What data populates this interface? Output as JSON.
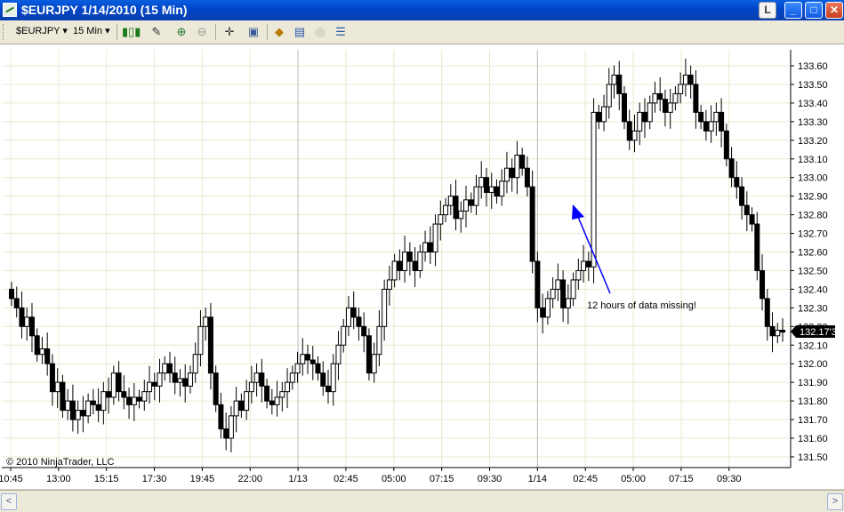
{
  "window": {
    "title": "$EURJPY  1/14/2010 (15 Min)",
    "btn_l": "L",
    "btn_min": "_",
    "btn_max": "□",
    "btn_close": "✕"
  },
  "toolbar": {
    "instrument": "$EURJPY",
    "interval": "15 Min",
    "icons": [
      "candlestick-icon",
      "pencil-icon",
      "zoom-in-icon",
      "zoom-out-icon",
      "crosshair-icon",
      "data-box-icon",
      "properties-icon",
      "chart-trader-icon",
      "strategy-icon",
      "data-series-icon"
    ]
  },
  "colors": {
    "up_fill": "#ffffff",
    "down_fill": "#000000",
    "grid": "#ede8d0",
    "arrow": "#0000ff",
    "last_price_bg": "#000000"
  },
  "chart_data": {
    "type": "candlestick",
    "title": "$EURJPY  1/14/2010 (15 Min)",
    "y_axis_ticks": [
      "133.60",
      "133.50",
      "133.40",
      "133.30",
      "133.20",
      "133.10",
      "133.00",
      "132.90",
      "132.80",
      "132.70",
      "132.60",
      "132.50",
      "132.40",
      "132.30",
      "132.20",
      "132.10",
      "132.00",
      "131.90",
      "131.80",
      "131.70",
      "131.60",
      "131.50"
    ],
    "ylim": [
      131.45,
      133.68
    ],
    "x_axis_ticks": [
      "10:45",
      "13:00",
      "15:15",
      "17:30",
      "19:45",
      "22:00",
      "1/13",
      "02:45",
      "05:00",
      "07:15",
      "09:30",
      "1/14",
      "02:45",
      "05:00",
      "07:15",
      "09:30"
    ],
    "last_price": "132.17'3",
    "annotation": "12 hours of data missing!",
    "copyright": "© 2010 NinjaTrader, LLC",
    "closes": [
      132.35,
      132.3,
      132.2,
      132.25,
      132.15,
      132.05,
      132.08,
      132.0,
      131.85,
      131.9,
      131.75,
      131.8,
      131.7,
      131.75,
      131.72,
      131.8,
      131.78,
      131.75,
      131.85,
      131.82,
      131.95,
      131.85,
      131.82,
      131.78,
      131.82,
      131.8,
      131.85,
      131.9,
      131.88,
      131.95,
      132.0,
      131.95,
      131.9,
      131.92,
      131.88,
      131.95,
      132.05,
      132.2,
      132.25,
      131.95,
      131.78,
      131.65,
      131.6,
      131.72,
      131.8,
      131.75,
      131.85,
      131.9,
      131.95,
      131.88,
      131.8,
      131.78,
      131.82,
      131.85,
      131.9,
      131.95,
      132.0,
      132.05,
      132.02,
      132.0,
      131.95,
      131.88,
      131.85,
      132.0,
      132.1,
      132.2,
      132.3,
      132.25,
      132.2,
      132.15,
      131.95,
      132.05,
      132.2,
      132.4,
      132.45,
      132.55,
      132.5,
      132.6,
      132.55,
      132.5,
      132.6,
      132.65,
      132.6,
      132.75,
      132.8,
      132.85,
      132.9,
      132.78,
      132.82,
      132.88,
      132.85,
      132.95,
      133.0,
      132.92,
      132.95,
      132.9,
      132.98,
      133.05,
      133.0,
      133.12,
      133.05,
      132.95,
      132.55,
      132.3,
      132.25,
      132.35,
      132.4,
      132.45,
      132.3,
      132.35,
      132.45,
      132.5,
      132.55,
      132.52,
      133.35,
      133.3,
      133.38,
      133.5,
      133.55,
      133.45,
      133.3,
      133.2,
      133.25,
      133.35,
      133.3,
      133.4,
      133.45,
      133.42,
      133.35,
      133.4,
      133.45,
      133.5,
      133.55,
      133.5,
      133.35,
      133.3,
      133.25,
      133.3,
      133.35,
      133.25,
      133.1,
      133.0,
      132.95,
      132.85,
      132.8,
      132.75,
      132.5,
      132.35,
      132.2,
      132.15,
      132.18,
      132.17
    ]
  }
}
